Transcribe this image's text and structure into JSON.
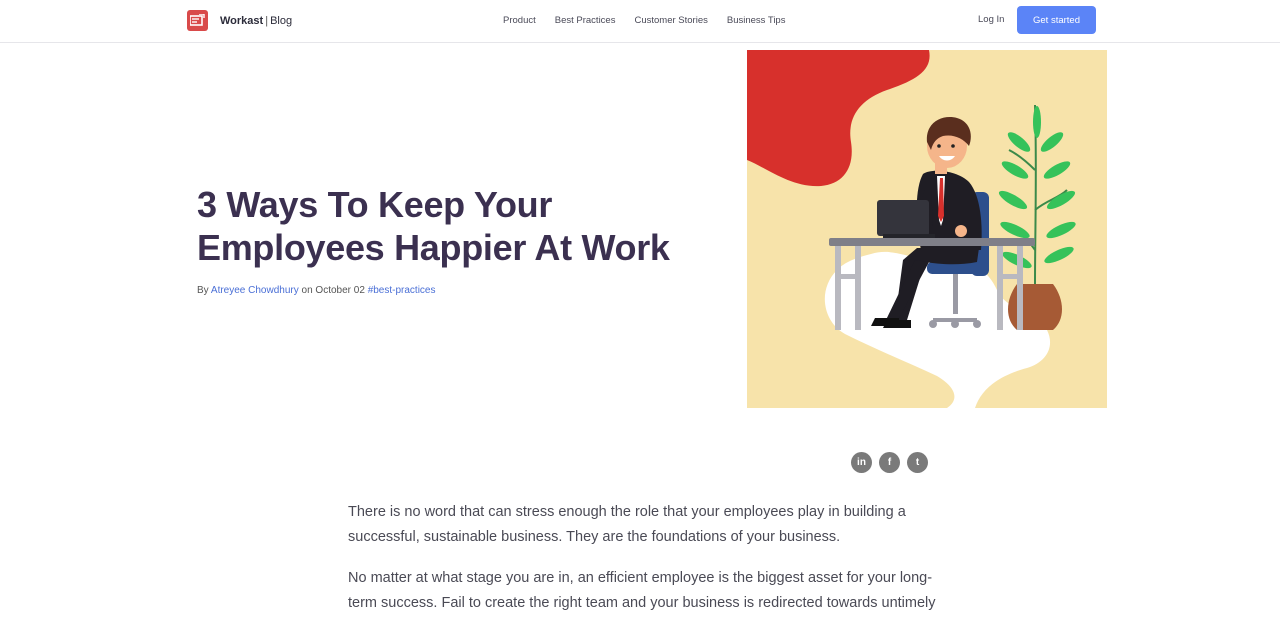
{
  "header": {
    "brand_name": "Workast",
    "brand_separator": "|",
    "brand_section": "Blog",
    "nav": [
      {
        "label": "Product"
      },
      {
        "label": "Best Practices"
      },
      {
        "label": "Customer Stories"
      },
      {
        "label": "Business Tips"
      }
    ],
    "login_label": "Log In",
    "cta_label": "Get started"
  },
  "post": {
    "title": "3 Ways To Keep Your Employees Happier At Work",
    "by_label": "By",
    "author": "Atreyee Chowdhury",
    "on_label": "on",
    "date": "October 02",
    "tag": "#best-practices"
  },
  "share": {
    "icons": [
      "linkedin-icon",
      "facebook-icon",
      "twitter-icon"
    ],
    "labels": [
      "in",
      "f",
      "t"
    ]
  },
  "article": {
    "paragraphs": [
      "There is no word that can stress enough the role that your employees play in building a successful, sustainable business. They are the foundations of your business.",
      "No matter at what stage you are in, an efficient employee is the biggest asset for your long-term success. Fail to create the right team and your business is redirected towards untimely"
    ]
  },
  "colors": {
    "accent": "#5b84f7",
    "brand_red": "#d94a4a",
    "title": "#3b3050",
    "link": "#4a6fd6",
    "hero_bg": "#f7e3aa"
  }
}
